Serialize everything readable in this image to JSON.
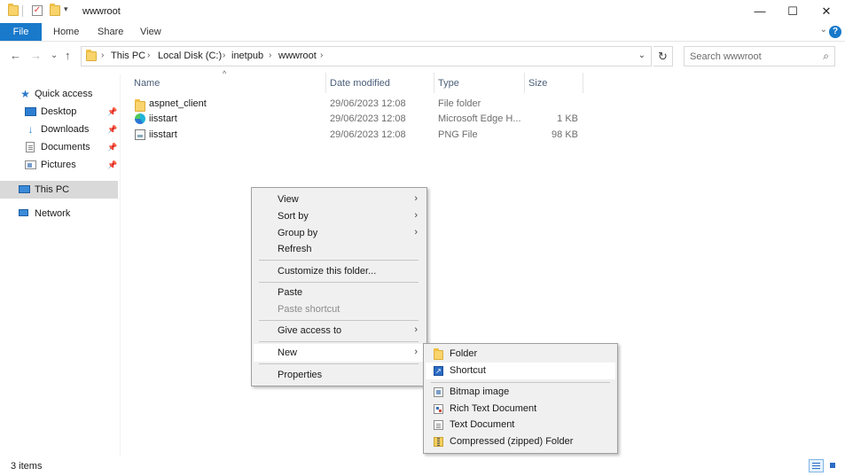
{
  "window": {
    "title": "wwwroot",
    "controls": {
      "minimize": "—",
      "maximize": "☐",
      "close": "✕"
    }
  },
  "ribbon": {
    "tabs": [
      "File",
      "Home",
      "Share",
      "View"
    ],
    "collapse_glyph": "⌄",
    "help_glyph": "?"
  },
  "navigation": {
    "back": "←",
    "forward": "→",
    "recent": "⌄",
    "up": "↑",
    "breadcrumb": [
      "This PC",
      "Local Disk (C:)",
      "inetpub",
      "wwwroot"
    ],
    "separator": "›",
    "refresh": "↻",
    "search_placeholder": "Search wwwroot"
  },
  "sidebar": {
    "quick_access": "Quick access",
    "items": [
      {
        "label": "Desktop",
        "icon": "desktop-icon",
        "pinned": true
      },
      {
        "label": "Downloads",
        "icon": "downloads-icon",
        "pinned": true
      },
      {
        "label": "Documents",
        "icon": "documents-icon",
        "pinned": true
      },
      {
        "label": "Pictures",
        "icon": "pictures-icon",
        "pinned": true
      }
    ],
    "this_pc": "This PC",
    "network": "Network",
    "pin_glyph": "📌"
  },
  "columns": {
    "name": "Name",
    "date": "Date modified",
    "type": "Type",
    "size": "Size",
    "sort_caret": "^"
  },
  "files": [
    {
      "name": "aspnet_client",
      "date": "29/06/2023 12:08",
      "type": "File folder",
      "size": "",
      "icon": "folder-icon"
    },
    {
      "name": "iisstart",
      "date": "29/06/2023 12:08",
      "type": "Microsoft Edge H...",
      "size": "1 KB",
      "icon": "edge-html-icon"
    },
    {
      "name": "iisstart",
      "date": "29/06/2023 12:08",
      "type": "PNG File",
      "size": "98 KB",
      "icon": "png-file-icon"
    }
  ],
  "context_menu": {
    "view": "View",
    "sort_by": "Sort by",
    "group_by": "Group by",
    "refresh": "Refresh",
    "customize": "Customize this folder...",
    "paste": "Paste",
    "paste_shortcut": "Paste shortcut",
    "give_access": "Give access to",
    "new": "New",
    "properties": "Properties",
    "arrow": "›"
  },
  "new_submenu": {
    "folder": "Folder",
    "shortcut": "Shortcut",
    "bitmap": "Bitmap image",
    "rtf": "Rich Text Document",
    "text": "Text Document",
    "zip": "Compressed (zipped) Folder"
  },
  "status": {
    "item_count": "3 items"
  },
  "colors": {
    "accent": "#1979ca",
    "header_text": "#4c607a",
    "menu_bg": "#f0f0f0",
    "selection": "#d9d9d9"
  }
}
